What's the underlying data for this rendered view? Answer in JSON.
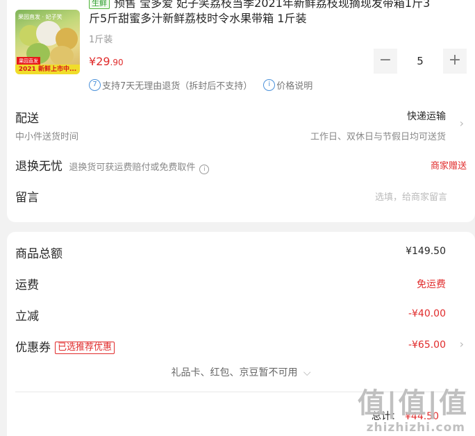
{
  "product": {
    "image_top_label": "果园直发 · 妃子笑",
    "image_brand": "果园直发",
    "image_banner": "2021 新鲜上市中...",
    "tag": "生鲜",
    "title_line1": "预售 莹多爱 妃子笑荔枝当季2021年新鲜荔枝现摘现发带箱1斤3",
    "title_line2": "斤5斤甜蜜多汁新鲜荔枝时令水果带箱 1斤装",
    "spec": "1斤装",
    "price_symbol": "¥",
    "price_int": "29",
    "price_dec": ".90",
    "quantity": "5",
    "minus_symbol": "−",
    "plus_symbol": "+",
    "return_icon": "7",
    "return_text": "支持7天无理由退货（拆封后不支持）",
    "price_info_icon": "i",
    "price_info_text": "价格说明"
  },
  "delivery": {
    "label": "配送",
    "sub": "中小件送货时间",
    "method": "快递运输",
    "detail": "工作日、双休日与节假日均可送货"
  },
  "worry_free": {
    "label": "退换无忧",
    "desc": "退换货可获运费赔付或免费取件",
    "info_icon": "i",
    "right": "商家赠送"
  },
  "message": {
    "label": "留言",
    "placeholder": "选填，给商家留言"
  },
  "summary": {
    "goods_total_label": "商品总额",
    "goods_total_value": "¥149.50",
    "shipping_label": "运费",
    "shipping_value": "免运费",
    "discount_label": "立减",
    "discount_value": "-¥40.00",
    "coupon_label": "优惠券",
    "coupon_badge": "已选推荐优惠",
    "coupon_value": "-¥65.00",
    "note": "礼品卡、红包、京豆暂不可用",
    "total_label": "总计：",
    "total_value": "¥44.50"
  },
  "icons": {
    "chevron": "›",
    "chevron_down": "⌵"
  },
  "watermark": {
    "main": "值|值|值",
    "sub": "zhizhizhi.com"
  },
  "colors": {
    "accent_red": "#e02b2b",
    "fresh_green": "#2f9e2f",
    "info_blue": "#4a90d9",
    "background": "#f2f2f2"
  }
}
